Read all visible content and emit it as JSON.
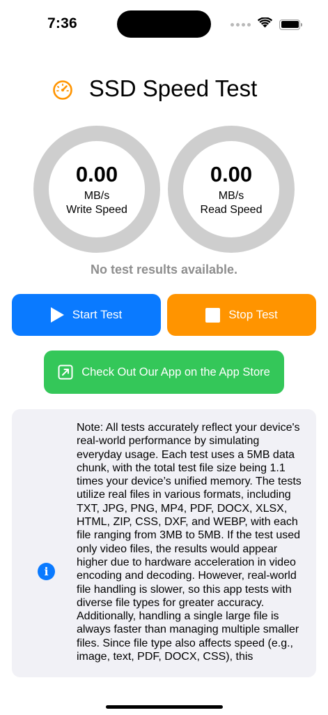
{
  "status_bar": {
    "time": "7:36"
  },
  "header": {
    "title": "SSD Speed Test",
    "icon": "speedometer-icon",
    "icon_color": "#ff9400"
  },
  "gauges": {
    "write": {
      "value": "0.00",
      "unit": "MB/s",
      "label": "Write Speed"
    },
    "read": {
      "value": "0.00",
      "unit": "MB/s",
      "label": "Read Speed"
    }
  },
  "status_message": "No test results available.",
  "buttons": {
    "start": {
      "label": "Start Test",
      "icon": "play-icon",
      "color": "#0a7aff"
    },
    "stop": {
      "label": "Stop Test",
      "icon": "stop-icon",
      "color": "#ff9400"
    },
    "app_store": {
      "label": "Check Out Our App on the App Store",
      "icon": "external-link-icon",
      "color": "#34c759"
    }
  },
  "info_note": {
    "icon": "info-icon",
    "text": "Note: All tests accurately reflect your device's real-world performance by simulating everyday usage. Each test uses a 5MB data chunk, with the total test file size being 1.1 times your device’s unified memory. The tests utilize real files in various formats, including TXT, JPG, PNG, MP4, PDF, DOCX, XLSX, HTML, ZIP, CSS, DXF, and WEBP, with each file ranging from 3MB to 5MB. If the test used only video files, the results would appear higher due to hardware acceleration in video encoding and decoding. However, real-world file handling is slower, so this app tests with diverse file types for greater accuracy. Additionally, handling a single large file is always faster than managing multiple smaller files. Since file type also affects speed (e.g., image, text, PDF, DOCX, CSS), this"
  }
}
